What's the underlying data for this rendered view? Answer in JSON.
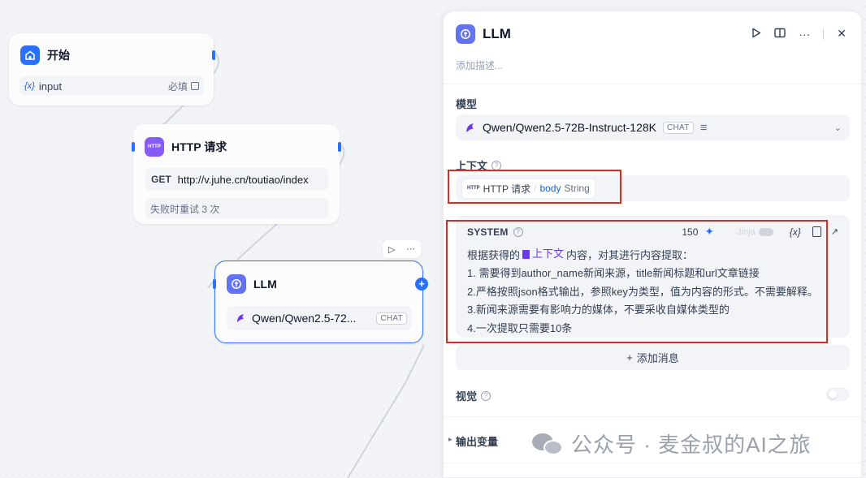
{
  "canvas": {
    "start_node": {
      "title": "开始",
      "variable": {
        "symbol": "{x}",
        "name": "input",
        "required_label": "必填"
      }
    },
    "http_node": {
      "badge": "HTTP",
      "title": "HTTP 请求",
      "method": "GET",
      "url": "http://v.juhe.cn/toutiao/index",
      "retry_text": "失败时重试 3 次"
    },
    "llm_node": {
      "title": "LLM",
      "model": "Qwen/Qwen2.5-72...",
      "model_mode": "CHAT",
      "add_symbol": "+",
      "toolbar_more": "···"
    }
  },
  "panel": {
    "title": "LLM",
    "description_placeholder": "添加描述...",
    "actions": {
      "close": "✕",
      "more": "···"
    },
    "model": {
      "label": "模型",
      "value": "Qwen/Qwen2.5-72B-Instruct-128K",
      "mode": "CHAT",
      "settings_icon": "≡"
    },
    "context": {
      "label": "上下文",
      "chip": {
        "badge": "HTTP",
        "node": "HTTP 请求",
        "separator": "/",
        "variable": "body",
        "type": "String"
      }
    },
    "prompt": {
      "role": "SYSTEM",
      "char_count": "150",
      "jinja_label": "Jinja",
      "var_button": "{x}",
      "line1_pre": "根据获得的",
      "line1_ref": "上下文",
      "line1_post": "内容，对其进行内容提取：",
      "lines": [
        "1. 需要得到author_name新闻来源，title新闻标题和url文章链接",
        "2.严格按照json格式输出，参照key为类型，值为内容的形式。不需要解释。",
        "3.新闻来源需要有影响力的媒体，不要采收自媒体类型的",
        "4.一次提取只需要10条"
      ]
    },
    "add_message": {
      "icon": "+",
      "label": "添加消息"
    },
    "vision": {
      "label": "视觉",
      "enabled": false
    },
    "output_vars": {
      "label": "输出变量"
    }
  },
  "watermark": {
    "text": "公众号 · 麦金叔的AI之旅"
  },
  "colors": {
    "accent": "#2970ff",
    "llm_icon": "#6172f3",
    "http_icon": "#875bf7",
    "start_icon": "#2970ff",
    "highlight_box": "#d92d20",
    "context_ref": "#6938ef"
  }
}
